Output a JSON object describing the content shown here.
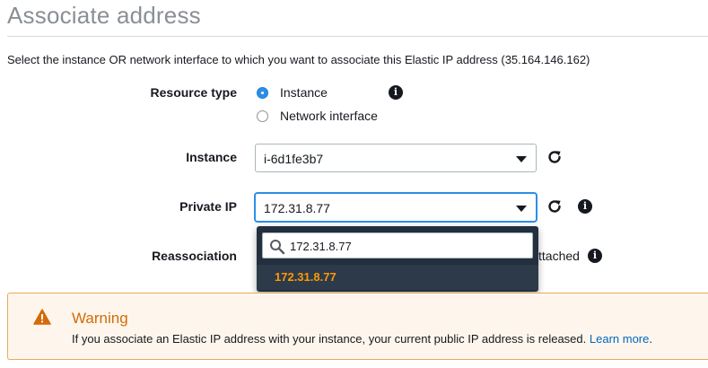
{
  "page": {
    "title": "Associate address",
    "description": "Select the instance OR network interface to which you want to associate this Elastic IP address (35.164.146.162)"
  },
  "form": {
    "resource_type": {
      "label": "Resource type",
      "options": [
        {
          "label": "Instance",
          "checked": true
        },
        {
          "label": "Network interface",
          "checked": false
        }
      ]
    },
    "instance": {
      "label": "Instance",
      "value": "i-6d1fe3b7"
    },
    "private_ip": {
      "label": "Private IP",
      "value": "172.31.8.77",
      "dropdown": {
        "search_value": "172.31.8.77",
        "options": [
          "172.31.8.77"
        ]
      }
    },
    "reassociation": {
      "label": "Reassociation",
      "visible_text": "ttached"
    }
  },
  "warning": {
    "title": "Warning",
    "body": "If you associate an Elastic IP address with your instance, your current public IP address is released.",
    "link_text": "Learn more",
    "trailing": "."
  },
  "colors": {
    "accent_blue": "#2d8ee8",
    "warning_orange": "#d36b0a",
    "dropdown_highlight": "#ff9900",
    "link_blue": "#0066c0"
  },
  "icons": {
    "info": "info-icon",
    "refresh": "refresh-icon",
    "search": "search-icon",
    "warning": "warning-triangle-icon",
    "caret": "chevron-down-icon"
  }
}
